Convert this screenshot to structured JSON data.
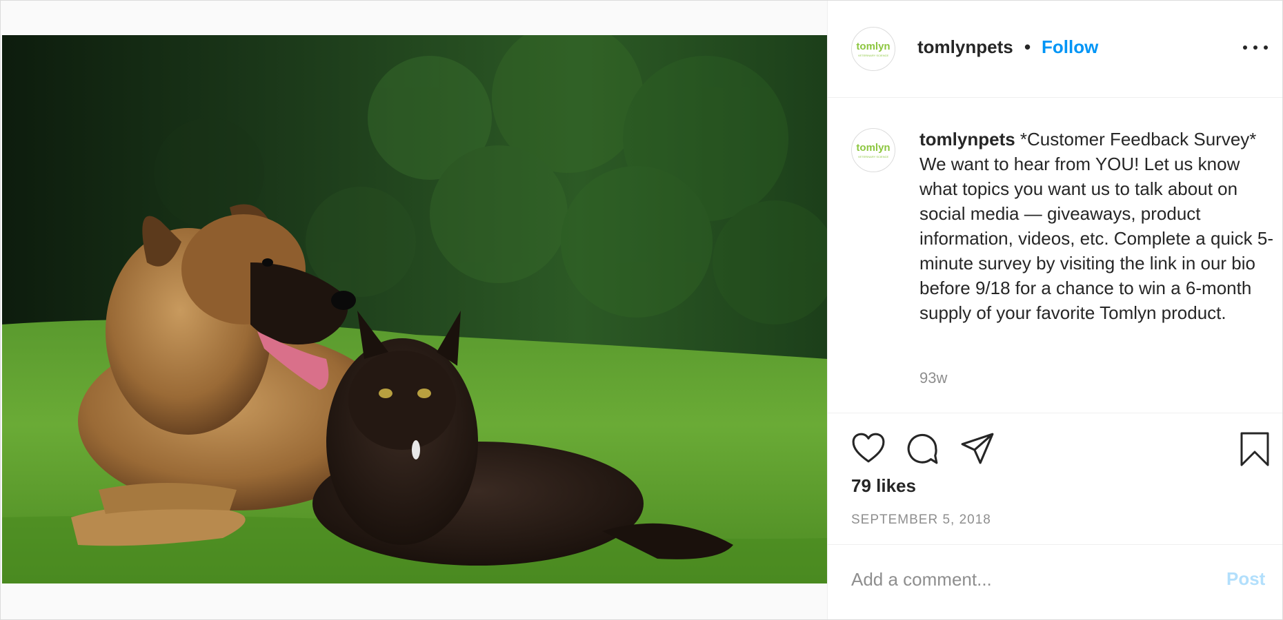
{
  "post": {
    "username": "tomlynpets",
    "separator": "•",
    "follow_label": "Follow",
    "avatar_logo_text": "tomlyn",
    "avatar_logo_subtext": "VETERINARY SCIENCE",
    "caption_text": " *Customer Feedback Survey* We want to hear from YOU! Let us know what topics you want us to talk about on social media — giveaways, product information, videos, etc. Complete a quick 5-minute survey by visiting the link in our bio before 9/18 for a chance to win a 6-month supply of your favorite Tomlyn product.",
    "relative_time": "93w",
    "likes": "79 likes",
    "date": "SEPTEMBER 5, 2018"
  },
  "comment": {
    "placeholder": "Add a comment...",
    "post_label": "Post"
  },
  "icons": [
    "more-icon",
    "heart-icon",
    "comment-icon",
    "share-icon",
    "bookmark-icon"
  ],
  "colors": {
    "link_blue": "#0095f6",
    "post_disabled": "#b2dffc",
    "muted": "#8e8e8e",
    "logo_green": "#8cc63f"
  }
}
